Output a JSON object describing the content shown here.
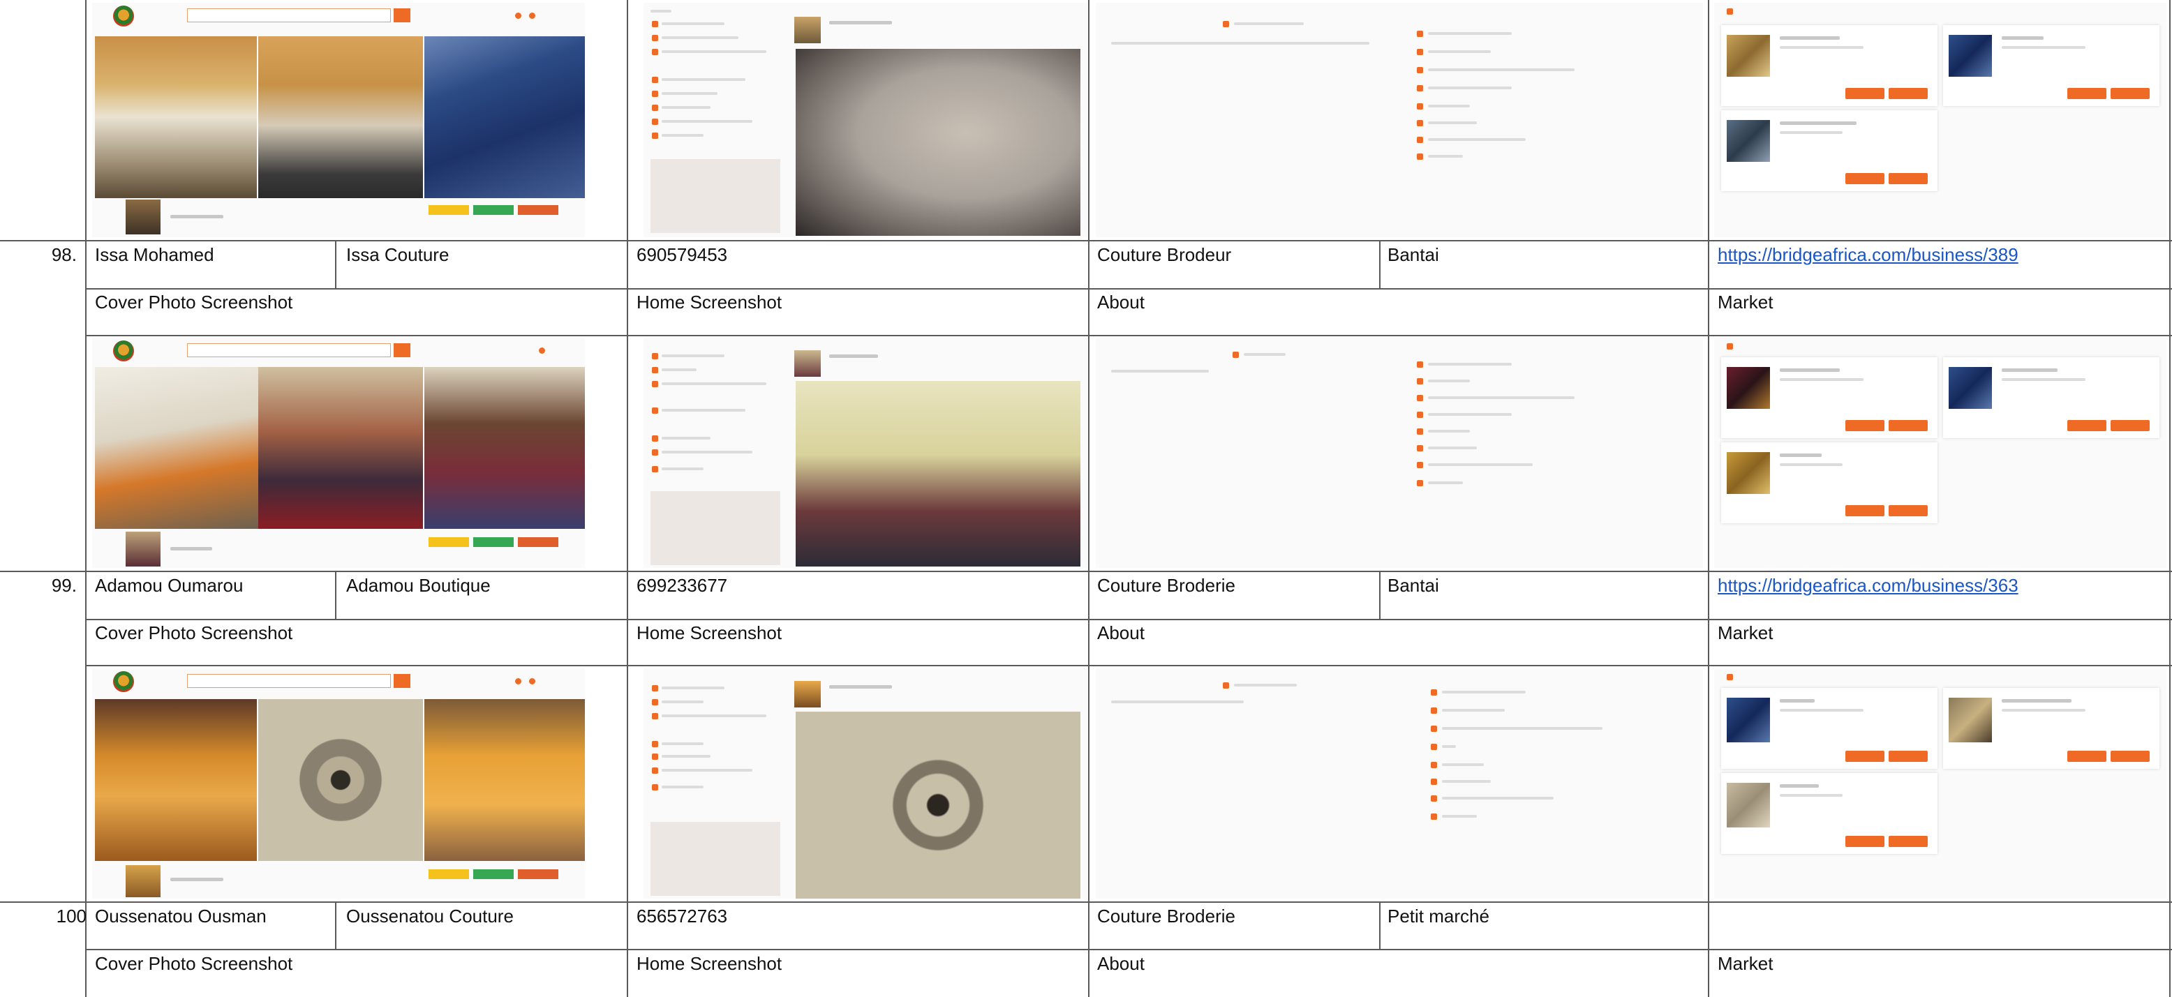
{
  "rows": [
    {
      "number": "98.",
      "name": "Issa Mohamed",
      "business": "Issa Couture",
      "phone": "690579453",
      "category": "Couture Brodeur",
      "location": "Bantai",
      "url": "https://bridgeafrica.com/business/389"
    },
    {
      "number": "99.",
      "name": "Adamou Oumarou",
      "business": "Adamou Boutique",
      "phone": "699233677",
      "category": "Couture Broderie",
      "location": "Bantai",
      "url": "https://bridgeafrica.com/business/363"
    },
    {
      "number": "100",
      "name": "Oussenatou Ousman",
      "business": "Oussenatou Couture",
      "phone": "656572763",
      "category": "Couture Broderie",
      "location": "Petit marché",
      "url": ""
    }
  ],
  "section_headers": {
    "cover": "Cover Photo Screenshot",
    "home": "Home Screenshot",
    "about": "About",
    "market": "Market"
  },
  "colors": {
    "brand_orange": "#ef6a24",
    "grid_line": "#5a5a5a",
    "link_blue": "#1a56c4"
  }
}
